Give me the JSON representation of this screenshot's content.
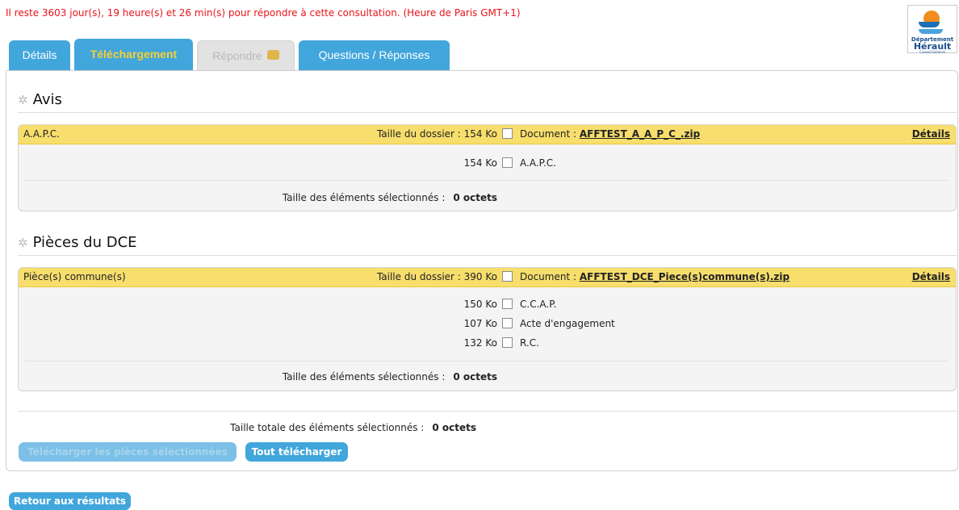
{
  "deadline_text": "Il reste 3603 jour(s), 19 heure(s) et 26 min(s) pour répondre à cette consultation. (Heure de Paris GMT+1)",
  "logo": {
    "line1": "Département",
    "line2": "Hérault",
    "line3": "Conseil Général"
  },
  "tabs": [
    {
      "label": "Détails",
      "state": "normal"
    },
    {
      "label": "Téléchargement",
      "state": "active"
    },
    {
      "label": "Répondre",
      "state": "disabled",
      "icon": "lock-icon"
    },
    {
      "label": "Questions / Réponses",
      "state": "normal"
    }
  ],
  "sections": [
    {
      "title": "Avis",
      "block": {
        "name": "A.A.P.C.",
        "size_text": "Taille du dossier : 154 Ko",
        "doc_label": "Document :",
        "doc_link": "AFFTEST_A_A_P_C_.zip",
        "details_label": "Détails",
        "items": [
          {
            "size": "154 Ko",
            "label": "A.A.P.C."
          }
        ],
        "selected_label": "Taille des éléments sélectionnés :",
        "selected_value": "0 octets"
      }
    },
    {
      "title": "Pièces du DCE",
      "block": {
        "name": "Pièce(s) commune(s)",
        "size_text": "Taille du dossier : 390 Ko",
        "doc_label": "Document :",
        "doc_link": "AFFTEST_DCE_Piece(s)commune(s).zip",
        "details_label": "Détails",
        "items": [
          {
            "size": "150 Ko",
            "label": "C.C.A.P."
          },
          {
            "size": "107 Ko",
            "label": "Acte d'engagement"
          },
          {
            "size": "132 Ko",
            "label": "R.C."
          }
        ],
        "selected_label": "Taille des éléments sélectionnés :",
        "selected_value": "0 octets"
      }
    }
  ],
  "total_label": "Taille totale des éléments sélectionnés :",
  "total_value": "0 octets",
  "buttons": {
    "download_selected": "Télécharger les pièces sélectionnées",
    "download_all": "Tout télécharger",
    "back": "Retour aux résultats"
  },
  "colors": {
    "accent_blue": "#41a6db",
    "header_yellow": "#f7de6d",
    "alert_red": "#e8141b",
    "active_tab_text": "#f6cf37"
  }
}
